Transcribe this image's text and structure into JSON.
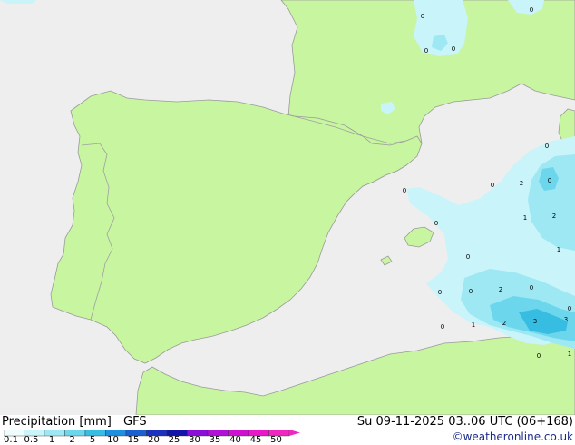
{
  "header": {
    "title": "Precipitation [mm]",
    "model": "GFS",
    "validity": "Su 09-11-2025 03..06 UTC (06+168)",
    "credit": "©weatheronline.co.uk"
  },
  "colors": {
    "sea": "#eeeeee",
    "land": "#c8f5a0",
    "coast": "#9a9a9a",
    "border": "#a0a0a0"
  },
  "legend": {
    "ticks": [
      "0.1",
      "0.5",
      "1",
      "2",
      "5",
      "10",
      "15",
      "20",
      "25",
      "30",
      "35",
      "40",
      "45",
      "50"
    ],
    "colors": [
      "#eefcfe",
      "#c8f4fa",
      "#9ee8f4",
      "#6cd6ec",
      "#38bde2",
      "#1f8fe0",
      "#1c5fd0",
      "#1a32bf",
      "#1414a8",
      "#8a10d8",
      "#b010d8",
      "#d010d0",
      "#e818c8",
      "#f028c0"
    ]
  },
  "map_labels": [
    {
      "id": "v1",
      "text": "0"
    },
    {
      "id": "v2",
      "text": "0"
    },
    {
      "id": "v3",
      "text": "0"
    },
    {
      "id": "v4",
      "text": "0"
    },
    {
      "id": "v5",
      "text": "0"
    },
    {
      "id": "v6",
      "text": "0"
    },
    {
      "id": "v7",
      "text": "2"
    },
    {
      "id": "v8",
      "text": "0"
    },
    {
      "id": "v9",
      "text": "0"
    },
    {
      "id": "v10",
      "text": "0"
    },
    {
      "id": "v11",
      "text": "1"
    },
    {
      "id": "v12",
      "text": "2"
    },
    {
      "id": "v13",
      "text": "0"
    },
    {
      "id": "v14",
      "text": "1"
    },
    {
      "id": "v15",
      "text": "0"
    },
    {
      "id": "v16",
      "text": "0"
    },
    {
      "id": "v17",
      "text": "0"
    },
    {
      "id": "v18",
      "text": "2"
    },
    {
      "id": "v19",
      "text": "0"
    },
    {
      "id": "v20",
      "text": "0"
    },
    {
      "id": "v21",
      "text": "1"
    },
    {
      "id": "v22",
      "text": "2"
    },
    {
      "id": "v23",
      "text": "3"
    },
    {
      "id": "v24",
      "text": "3"
    },
    {
      "id": "v25",
      "text": "0"
    },
    {
      "id": "v26",
      "text": "1"
    }
  ]
}
